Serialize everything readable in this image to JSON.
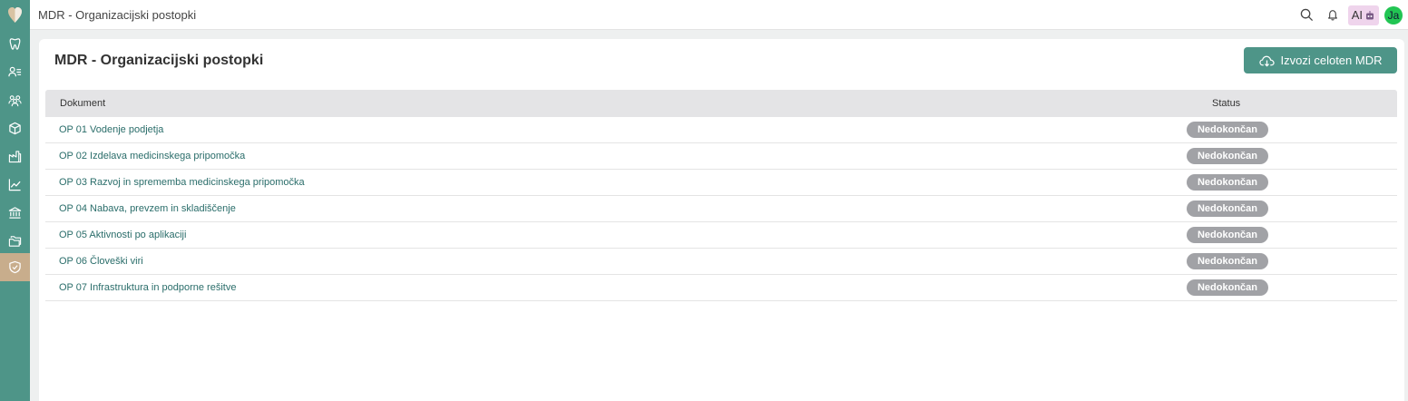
{
  "topbar": {
    "title": "MDR - Organizacijski postopki",
    "ai_label": "AI",
    "avatar_initials": "Ja"
  },
  "sidebar": {
    "items": [
      {
        "icon": "tooth-icon",
        "active": false
      },
      {
        "icon": "patients-icon",
        "active": false
      },
      {
        "icon": "team-icon",
        "active": false
      },
      {
        "icon": "box-icon",
        "active": false
      },
      {
        "icon": "factory-icon",
        "active": false
      },
      {
        "icon": "chart-icon",
        "active": false
      },
      {
        "icon": "bank-icon",
        "active": false
      },
      {
        "icon": "folders-icon",
        "active": false
      },
      {
        "icon": "shield-check-icon",
        "active": true
      }
    ]
  },
  "main": {
    "page_title": "MDR - Organizacijski postopki",
    "export_label": "Izvozi celoten MDR",
    "columns": {
      "document": "Dokument",
      "status": "Status"
    },
    "rows": [
      {
        "document": "OP 01 Vodenje podjetja",
        "status": "Nedokončan"
      },
      {
        "document": "OP 02 Izdelava medicinskega pripomočka",
        "status": "Nedokončan"
      },
      {
        "document": "OP 03 Razvoj in sprememba medicinskega pripomočka",
        "status": "Nedokončan"
      },
      {
        "document": "OP 04 Nabava, prevzem in skladiščenje",
        "status": "Nedokončan"
      },
      {
        "document": "OP 05 Aktivnosti po aplikaciji",
        "status": "Nedokončan"
      },
      {
        "document": "OP 06 Človeški viri",
        "status": "Nedokončan"
      },
      {
        "document": "OP 07 Infrastruktura in podporne rešitve",
        "status": "Nedokončan"
      }
    ]
  },
  "colors": {
    "brand": "#4e9588",
    "active_nav": "#c8ad8c",
    "badge": "#a1a2a6",
    "link": "#2a6d6a"
  }
}
